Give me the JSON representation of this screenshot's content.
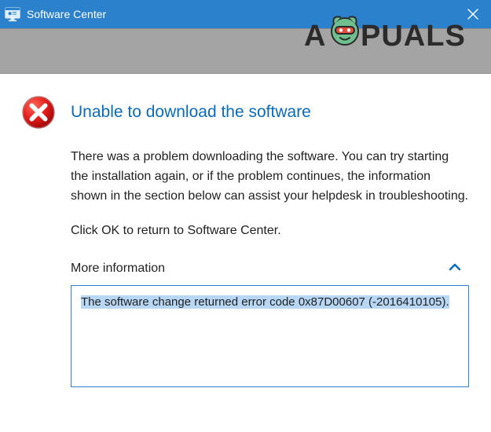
{
  "window": {
    "title": "Software Center"
  },
  "watermark": "APPUALS",
  "dialog": {
    "heading": "Unable to download the software",
    "paragraph1": "There was a problem downloading the software.  You can try starting the installation again, or if the problem continues, the information shown in the section below can assist your helpdesk in troubleshooting.",
    "paragraph2": "Click OK to return to Software Center.",
    "more_info_label": "More information",
    "details": "The software change returned error code 0x87D00607 (-2016410105)."
  }
}
